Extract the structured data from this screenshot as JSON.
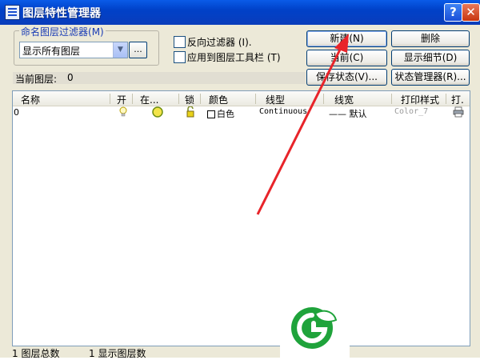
{
  "window": {
    "title": "图层特性管理器",
    "help_glyph": "?",
    "close_glyph": "✕"
  },
  "filter": {
    "group_label": "命名图层过滤器",
    "group_label_key": "(M)",
    "selected": "显示所有图层",
    "dropdown_glyph": "▼",
    "more_label": "...",
    "invert_label": "反向过滤器",
    "invert_key": "(I).",
    "apply_toolbar_label": "应用到图层工具栏",
    "apply_toolbar_key": "(T)"
  },
  "buttons": {
    "new": "新建(N)",
    "delete": "删除",
    "current": "当前(C)",
    "show_details": "显示细节(D)",
    "save_state": "保存状态(V)...",
    "state_manager": "状态管理器(R)..."
  },
  "current_layer": {
    "label": "当前图层:",
    "value": "0"
  },
  "table": {
    "columns": [
      "名称",
      "开",
      "在...",
      "锁",
      "颜色",
      "线型",
      "线宽",
      "打印样式",
      "打."
    ],
    "rows": [
      {
        "name": "0",
        "color": "白色",
        "linetype": "Continuous",
        "lineweight": "—— 默认",
        "plot_style": "Color_7"
      }
    ]
  },
  "status": {
    "total": "1 图层总数",
    "shown": "1 显示图层数"
  },
  "colors": {
    "arrow": "#e8242a",
    "logo_green": "#1fa33b",
    "title_blue": "#0a46d2"
  },
  "icons": [
    "help-icon",
    "close-icon",
    "lightbulb-icon",
    "sun-icon",
    "lock-icon",
    "printer-icon",
    "logo-mark"
  ]
}
